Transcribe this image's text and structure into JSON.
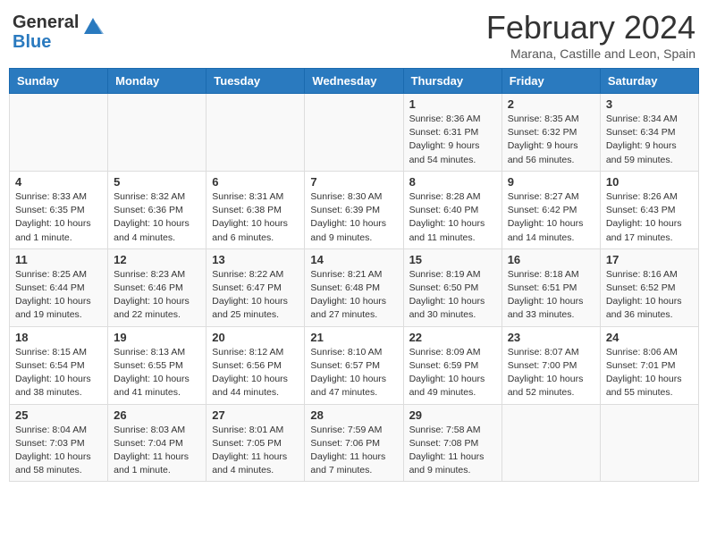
{
  "header": {
    "logo_general": "General",
    "logo_blue": "Blue",
    "month_title": "February 2024",
    "subtitle": "Marana, Castille and Leon, Spain"
  },
  "days_of_week": [
    "Sunday",
    "Monday",
    "Tuesday",
    "Wednesday",
    "Thursday",
    "Friday",
    "Saturday"
  ],
  "weeks": [
    [
      {
        "day": "",
        "info": ""
      },
      {
        "day": "",
        "info": ""
      },
      {
        "day": "",
        "info": ""
      },
      {
        "day": "",
        "info": ""
      },
      {
        "day": "1",
        "info": "Sunrise: 8:36 AM\nSunset: 6:31 PM\nDaylight: 9 hours\nand 54 minutes."
      },
      {
        "day": "2",
        "info": "Sunrise: 8:35 AM\nSunset: 6:32 PM\nDaylight: 9 hours\nand 56 minutes."
      },
      {
        "day": "3",
        "info": "Sunrise: 8:34 AM\nSunset: 6:34 PM\nDaylight: 9 hours\nand 59 minutes."
      }
    ],
    [
      {
        "day": "4",
        "info": "Sunrise: 8:33 AM\nSunset: 6:35 PM\nDaylight: 10 hours\nand 1 minute."
      },
      {
        "day": "5",
        "info": "Sunrise: 8:32 AM\nSunset: 6:36 PM\nDaylight: 10 hours\nand 4 minutes."
      },
      {
        "day": "6",
        "info": "Sunrise: 8:31 AM\nSunset: 6:38 PM\nDaylight: 10 hours\nand 6 minutes."
      },
      {
        "day": "7",
        "info": "Sunrise: 8:30 AM\nSunset: 6:39 PM\nDaylight: 10 hours\nand 9 minutes."
      },
      {
        "day": "8",
        "info": "Sunrise: 8:28 AM\nSunset: 6:40 PM\nDaylight: 10 hours\nand 11 minutes."
      },
      {
        "day": "9",
        "info": "Sunrise: 8:27 AM\nSunset: 6:42 PM\nDaylight: 10 hours\nand 14 minutes."
      },
      {
        "day": "10",
        "info": "Sunrise: 8:26 AM\nSunset: 6:43 PM\nDaylight: 10 hours\nand 17 minutes."
      }
    ],
    [
      {
        "day": "11",
        "info": "Sunrise: 8:25 AM\nSunset: 6:44 PM\nDaylight: 10 hours\nand 19 minutes."
      },
      {
        "day": "12",
        "info": "Sunrise: 8:23 AM\nSunset: 6:46 PM\nDaylight: 10 hours\nand 22 minutes."
      },
      {
        "day": "13",
        "info": "Sunrise: 8:22 AM\nSunset: 6:47 PM\nDaylight: 10 hours\nand 25 minutes."
      },
      {
        "day": "14",
        "info": "Sunrise: 8:21 AM\nSunset: 6:48 PM\nDaylight: 10 hours\nand 27 minutes."
      },
      {
        "day": "15",
        "info": "Sunrise: 8:19 AM\nSunset: 6:50 PM\nDaylight: 10 hours\nand 30 minutes."
      },
      {
        "day": "16",
        "info": "Sunrise: 8:18 AM\nSunset: 6:51 PM\nDaylight: 10 hours\nand 33 minutes."
      },
      {
        "day": "17",
        "info": "Sunrise: 8:16 AM\nSunset: 6:52 PM\nDaylight: 10 hours\nand 36 minutes."
      }
    ],
    [
      {
        "day": "18",
        "info": "Sunrise: 8:15 AM\nSunset: 6:54 PM\nDaylight: 10 hours\nand 38 minutes."
      },
      {
        "day": "19",
        "info": "Sunrise: 8:13 AM\nSunset: 6:55 PM\nDaylight: 10 hours\nand 41 minutes."
      },
      {
        "day": "20",
        "info": "Sunrise: 8:12 AM\nSunset: 6:56 PM\nDaylight: 10 hours\nand 44 minutes."
      },
      {
        "day": "21",
        "info": "Sunrise: 8:10 AM\nSunset: 6:57 PM\nDaylight: 10 hours\nand 47 minutes."
      },
      {
        "day": "22",
        "info": "Sunrise: 8:09 AM\nSunset: 6:59 PM\nDaylight: 10 hours\nand 49 minutes."
      },
      {
        "day": "23",
        "info": "Sunrise: 8:07 AM\nSunset: 7:00 PM\nDaylight: 10 hours\nand 52 minutes."
      },
      {
        "day": "24",
        "info": "Sunrise: 8:06 AM\nSunset: 7:01 PM\nDaylight: 10 hours\nand 55 minutes."
      }
    ],
    [
      {
        "day": "25",
        "info": "Sunrise: 8:04 AM\nSunset: 7:03 PM\nDaylight: 10 hours\nand 58 minutes."
      },
      {
        "day": "26",
        "info": "Sunrise: 8:03 AM\nSunset: 7:04 PM\nDaylight: 11 hours\nand 1 minute."
      },
      {
        "day": "27",
        "info": "Sunrise: 8:01 AM\nSunset: 7:05 PM\nDaylight: 11 hours\nand 4 minutes."
      },
      {
        "day": "28",
        "info": "Sunrise: 7:59 AM\nSunset: 7:06 PM\nDaylight: 11 hours\nand 7 minutes."
      },
      {
        "day": "29",
        "info": "Sunrise: 7:58 AM\nSunset: 7:08 PM\nDaylight: 11 hours\nand 9 minutes."
      },
      {
        "day": "",
        "info": ""
      },
      {
        "day": "",
        "info": ""
      }
    ]
  ]
}
